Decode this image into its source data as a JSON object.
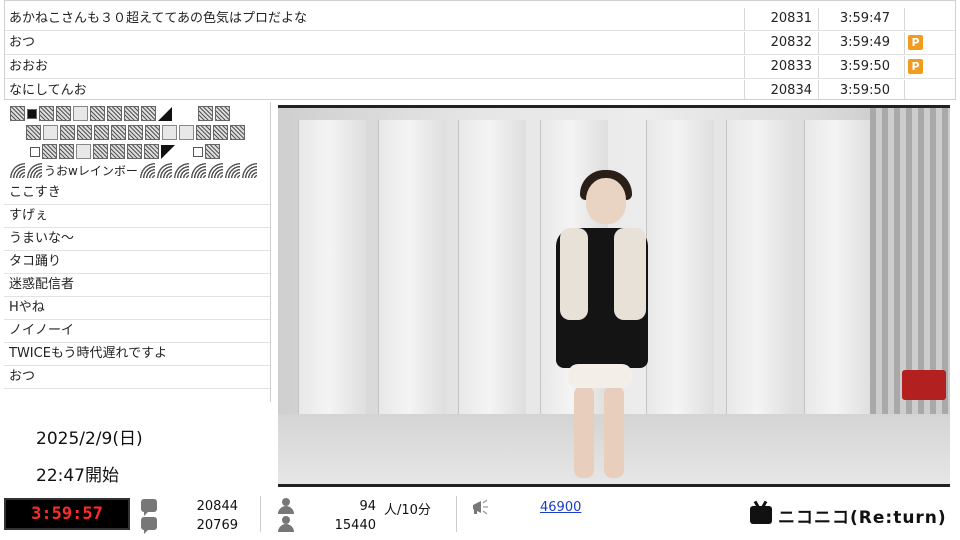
{
  "top_comments": [
    {
      "text": "あかねこさんも３０超えててあの色気はプロだよな",
      "no": "20831",
      "time": "3:59:47",
      "premium": false
    },
    {
      "text": "おつ",
      "no": "20832",
      "time": "3:59:49",
      "premium": true
    },
    {
      "text": "おおお",
      "no": "20833",
      "time": "3:59:50",
      "premium": true
    },
    {
      "text": "なにしてんお",
      "no": "20834",
      "time": "3:59:50",
      "premium": false
    }
  ],
  "premium_badge": "P",
  "art_text": "うおwレインボー",
  "left_comments": [
    "ここすき",
    "すげぇ",
    "うまいな～",
    "タコ踊り",
    "迷惑配信者",
    "Hやね",
    "ノイノーイ",
    "TWICEもう時代遅れですよ",
    "おつ"
  ],
  "broadcast": {
    "date": "2025/2/9(日)",
    "start": "22:47開始"
  },
  "status": {
    "timer": "3:59:57",
    "comments_total": "20844",
    "comments_sub": "20769",
    "viewers_now": "94",
    "viewers_unit": "人/10分",
    "viewers_total": "15440",
    "ad_points": "46900"
  },
  "logo": "ニコニコ(Re:turn)"
}
